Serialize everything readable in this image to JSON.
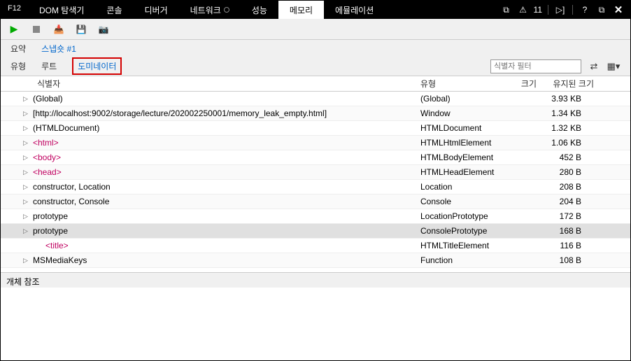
{
  "titlebar": {
    "f12": "F12",
    "tabs": [
      "DOM 탐색기",
      "콘솔",
      "디버거",
      "네트워크",
      "성능",
      "메모리",
      "에뮬레이션"
    ],
    "activeTab": "메모리",
    "warnCount": "11"
  },
  "subtabs1": {
    "summary": "요약",
    "snapshot": "스냅숏 #1"
  },
  "subtabs2": {
    "type": "유형",
    "root": "루트",
    "dominator": "도미네이터",
    "filterPlaceholder": "식별자 필터"
  },
  "columns": {
    "id": "식별자",
    "type": "유형",
    "size": "크기",
    "retained": "유지된 크기"
  },
  "rows": [
    {
      "indent": 0,
      "exp": true,
      "ident": "(Global)",
      "html": false,
      "type": "(Global)",
      "size": "",
      "ret": "3.93 KB",
      "sel": false
    },
    {
      "indent": 0,
      "exp": true,
      "ident": "[http://localhost:9002/storage/lecture/202002250001/memory_leak_empty.html]",
      "html": false,
      "type": "Window",
      "size": "",
      "ret": "1.34 KB",
      "sel": false
    },
    {
      "indent": 0,
      "exp": true,
      "ident": "(HTMLDocument)",
      "html": false,
      "type": "HTMLDocument",
      "size": "",
      "ret": "1.32 KB",
      "sel": false
    },
    {
      "indent": 0,
      "exp": true,
      "ident": "<html>",
      "html": true,
      "type": "HTMLHtmlElement",
      "size": "",
      "ret": "1.06 KB",
      "sel": false
    },
    {
      "indent": 0,
      "exp": true,
      "ident": "<body>",
      "html": true,
      "type": "HTMLBodyElement",
      "size": "",
      "ret": "452 B",
      "sel": false
    },
    {
      "indent": 0,
      "exp": true,
      "ident": "<head>",
      "html": true,
      "type": "HTMLHeadElement",
      "size": "",
      "ret": "280 B",
      "sel": false
    },
    {
      "indent": 0,
      "exp": true,
      "ident": "constructor, Location",
      "html": false,
      "type": "Location",
      "size": "",
      "ret": "208 B",
      "sel": false
    },
    {
      "indent": 0,
      "exp": true,
      "ident": "constructor, Console",
      "html": false,
      "type": "Console",
      "size": "",
      "ret": "204 B",
      "sel": false
    },
    {
      "indent": 0,
      "exp": true,
      "ident": "prototype",
      "html": false,
      "type": "LocationPrototype",
      "size": "",
      "ret": "172 B",
      "sel": false
    },
    {
      "indent": 0,
      "exp": true,
      "ident": "prototype",
      "html": false,
      "type": "ConsolePrototype",
      "size": "",
      "ret": "168 B",
      "sel": true
    },
    {
      "indent": 1,
      "exp": false,
      "ident": "<title>",
      "html": true,
      "type": "HTMLTitleElement",
      "size": "",
      "ret": "116 B",
      "sel": false
    },
    {
      "indent": 0,
      "exp": true,
      "ident": "MSMediaKeys",
      "html": false,
      "type": "Function",
      "size": "",
      "ret": "108 B",
      "sel": false
    }
  ],
  "bottom": {
    "label": "개체 참조"
  }
}
